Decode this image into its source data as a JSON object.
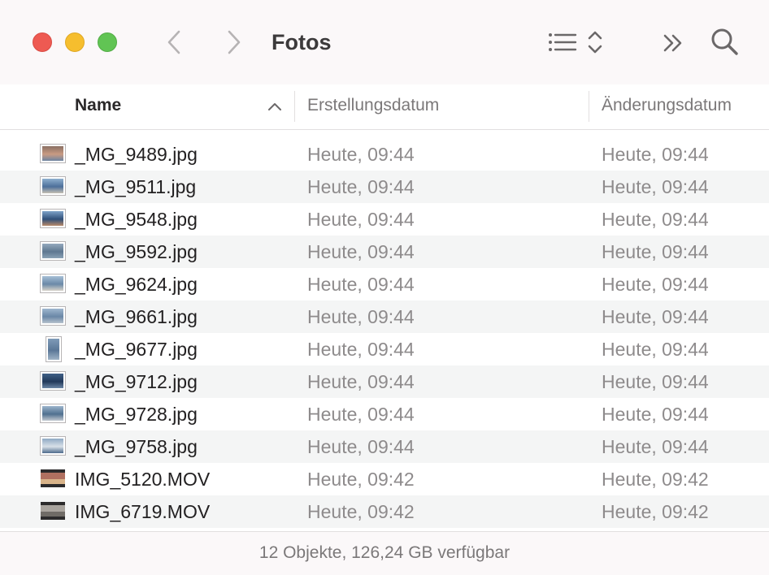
{
  "window": {
    "title": "Fotos"
  },
  "toolbar": {
    "back_icon": "chevron-left-icon",
    "forward_icon": "chevron-right-icon",
    "view_icon": "list-view-icon",
    "sort_icon": "up-down-chevron-icon",
    "more_icon": "double-chevron-right-icon",
    "search_icon": "magnifier-icon"
  },
  "columns": {
    "name": "Name",
    "created": "Erstellungsdatum",
    "modified": "Änderungsdatum"
  },
  "files": [
    {
      "name": "_MG_9489.jpg",
      "created": "Heute, 09:44",
      "modified": "Heute, 09:44",
      "icon": "image-thumbnail-icon",
      "kind": "landscape",
      "thumb": [
        "#8a6f63",
        "#c99b83",
        "#6d84a1"
      ]
    },
    {
      "name": "_MG_9511.jpg",
      "created": "Heute, 09:44",
      "modified": "Heute, 09:44",
      "icon": "image-thumbnail-icon",
      "kind": "landscape",
      "thumb": [
        "#8fb0cf",
        "#4d6f9a",
        "#c6c0b4"
      ]
    },
    {
      "name": "_MG_9548.jpg",
      "created": "Heute, 09:44",
      "modified": "Heute, 09:44",
      "icon": "image-thumbnail-icon",
      "kind": "landscape",
      "thumb": [
        "#7da2c8",
        "#2f4f78",
        "#b88a6a"
      ]
    },
    {
      "name": "_MG_9592.jpg",
      "created": "Heute, 09:44",
      "modified": "Heute, 09:44",
      "icon": "image-thumbnail-icon",
      "kind": "landscape",
      "thumb": [
        "#94a9bd",
        "#5e7790",
        "#8aa1b5"
      ]
    },
    {
      "name": "_MG_9624.jpg",
      "created": "Heute, 09:44",
      "modified": "Heute, 09:44",
      "icon": "image-thumbnail-icon",
      "kind": "landscape",
      "thumb": [
        "#a6bfd6",
        "#6b89a8",
        "#d7d2c9"
      ]
    },
    {
      "name": "_MG_9661.jpg",
      "created": "Heute, 09:44",
      "modified": "Heute, 09:44",
      "icon": "image-thumbnail-icon",
      "kind": "landscape",
      "thumb": [
        "#9fb7cf",
        "#6a87a6",
        "#b6c2cd"
      ]
    },
    {
      "name": "_MG_9677.jpg",
      "created": "Heute, 09:44",
      "modified": "Heute, 09:44",
      "icon": "image-thumbnail-icon",
      "kind": "portrait",
      "thumb": [
        "#7f9bb8",
        "#5a7797",
        "#9fb3c6"
      ]
    },
    {
      "name": "_MG_9712.jpg",
      "created": "Heute, 09:44",
      "modified": "Heute, 09:44",
      "icon": "image-thumbnail-icon",
      "kind": "landscape",
      "thumb": [
        "#3f5f86",
        "#22395a",
        "#6b86a5"
      ]
    },
    {
      "name": "_MG_9728.jpg",
      "created": "Heute, 09:44",
      "modified": "Heute, 09:44",
      "icon": "image-thumbnail-icon",
      "kind": "landscape",
      "thumb": [
        "#9cb4cc",
        "#50708f",
        "#c2c9d0"
      ]
    },
    {
      "name": "_MG_9758.jpg",
      "created": "Heute, 09:44",
      "modified": "Heute, 09:44",
      "icon": "image-thumbnail-icon",
      "kind": "landscape",
      "thumb": [
        "#8fa9c4",
        "#d8e0e8",
        "#4e6b8c"
      ]
    },
    {
      "name": "IMG_5120.MOV",
      "created": "Heute, 09:42",
      "modified": "Heute, 09:42",
      "icon": "video-thumbnail-icon",
      "kind": "video",
      "thumb": [
        "#2c2b2c",
        "#b07060",
        "#d9b48a"
      ]
    },
    {
      "name": "IMG_6719.MOV",
      "created": "Heute, 09:42",
      "modified": "Heute, 09:42",
      "icon": "video-thumbnail-icon",
      "kind": "video",
      "thumb": [
        "#2c2b2c",
        "#a9a49e",
        "#6f6b66"
      ]
    }
  ],
  "status": {
    "text": "12 Objekte, 126,24 GB verfügbar"
  }
}
